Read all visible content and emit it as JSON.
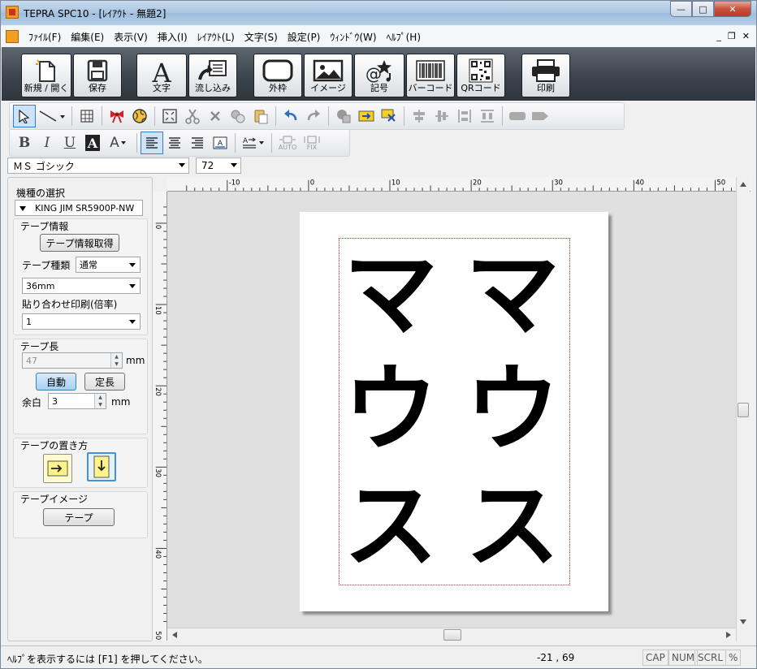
{
  "window": {
    "title": "TEPRA SPC10 - [ﾚｲｱｳﾄ - 無題2]",
    "minimize": "—",
    "maximize": "□",
    "close": "✕"
  },
  "menu": {
    "items": [
      "ﾌｧｲﾙ(F)",
      "編集(E)",
      "表示(V)",
      "挿入(I)",
      "ﾚｲｱｳﾄ(L)",
      "文字(S)",
      "設定(P)",
      "ｳｨﾝﾄﾞｳ(W)",
      "ﾍﾙﾌﾟ(H)"
    ],
    "mdi_min": "_",
    "mdi_restore": "❐",
    "mdi_close": "✕"
  },
  "big_toolbar": {
    "new_open": "新規 / 開く",
    "save": "保存",
    "text": "文字",
    "flow": "流し込み",
    "frame": "外枠",
    "image": "イメージ",
    "symbol": "記号",
    "barcode": "バーコード",
    "qrcode": "QRコード",
    "print": "印刷"
  },
  "toolbar2": {
    "bold": "B",
    "italic": "I",
    "underline": "U",
    "font_color": "A",
    "auto_label": "AUTO",
    "fix_label": "FIX"
  },
  "font": {
    "family": "ＭＳ ゴシック",
    "size": "72"
  },
  "left_panel": {
    "model_label": "機種の選択",
    "model_value": "KING JIM SR5900P-NW",
    "tape_info_title": "テープ情報",
    "tape_info_button": "テープ情報取得",
    "tape_type_label": "テープ種類",
    "tape_type_value": "通常",
    "tape_width_value": "36mm",
    "merge_print_label": "貼り合わせ印刷(倍率)",
    "merge_print_value": "1",
    "tape_length_title": "テープ長",
    "tape_length_value": "47",
    "tape_length_unit": "mm",
    "auto_button": "自動",
    "fixed_button": "定長",
    "margin_label": "余白",
    "margin_value": "3",
    "margin_unit": "mm",
    "placement_title": "テープの置き方",
    "tape_image_title": "テープイメージ",
    "tape_image_button": "テープ"
  },
  "ruler": {
    "h_labels": [
      "-10",
      "0",
      "10",
      "20",
      "30",
      "40",
      "50"
    ],
    "v_labels": [
      "0",
      "10",
      "20",
      "30",
      "40",
      "50"
    ]
  },
  "document": {
    "column1": [
      "マ",
      "ウ",
      "ス"
    ],
    "column2": [
      "マ",
      "ウ",
      "ス"
    ]
  },
  "status": {
    "help": "ﾍﾙﾌﾟを表示するには [F1] を押してください。",
    "coords": "-21 , 69",
    "cap": "CAP",
    "num": "NUM",
    "scrl": "SCRL",
    "pct": "%"
  }
}
